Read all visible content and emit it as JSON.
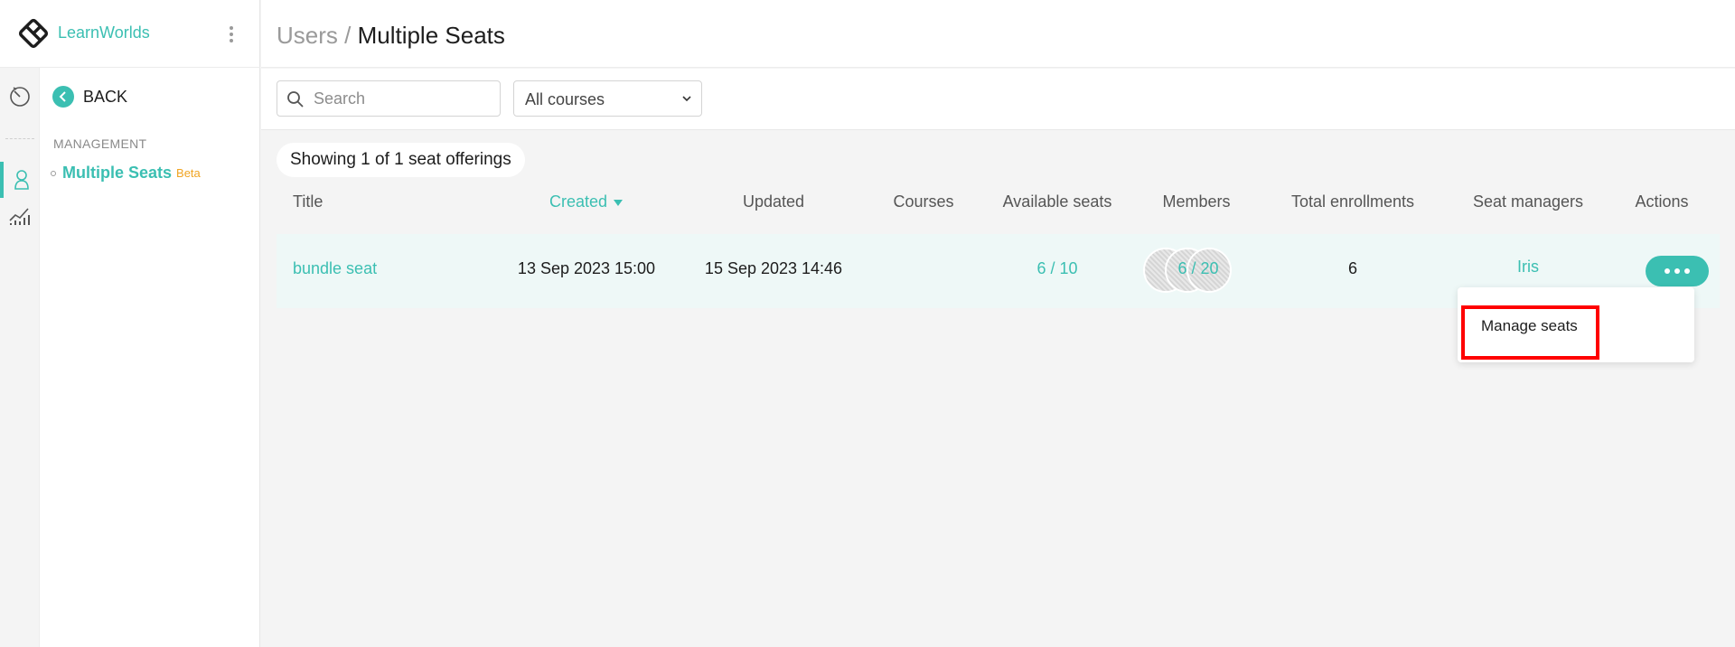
{
  "brand": {
    "name": "LearnWorlds",
    "logo_icon": "learnworlds-logo-icon"
  },
  "nav": {
    "back_label": "BACK",
    "section_title": "MANAGEMENT",
    "item_label": "Multiple Seats",
    "item_badge": "Beta"
  },
  "header": {
    "breadcrumb_parent": "Users",
    "breadcrumb_separator": " / ",
    "breadcrumb_current": "Multiple Seats"
  },
  "toolbar": {
    "search_placeholder": "Search",
    "course_filter": "All courses"
  },
  "results": {
    "summary": "Showing 1 of 1 seat offerings"
  },
  "table": {
    "columns": {
      "title": "Title",
      "created": "Created",
      "updated": "Updated",
      "courses": "Courses",
      "available_seats": "Available seats",
      "members": "Members",
      "total_enrollments": "Total enrollments",
      "seat_managers": "Seat managers",
      "actions": "Actions"
    },
    "sort": {
      "column": "Created",
      "direction": "desc"
    },
    "rows": [
      {
        "title": "bundle seat",
        "created": "13 Sep 2023 15:00",
        "updated": "15 Sep 2023 14:46",
        "available_seats": "6 / 10",
        "members": "6 / 20",
        "total_enrollments": "6",
        "seat_managers": "Iris"
      }
    ]
  },
  "actions_menu": {
    "items": [
      "Manage seats"
    ]
  },
  "colors": {
    "accent": "#3bbfb2",
    "beta": "#f0a422",
    "highlight": "#ff0000",
    "row_bg": "#eef8f7"
  }
}
